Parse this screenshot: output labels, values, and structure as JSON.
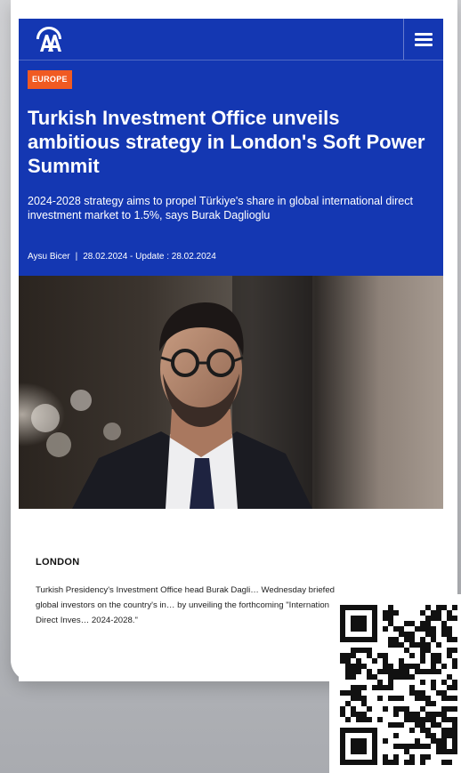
{
  "header": {
    "brand_logo": "AA",
    "menu_icon": "hamburger-menu-icon",
    "brand_color": "#1437b2",
    "category_color": "#f05a22"
  },
  "article": {
    "category": "EUROPE",
    "headline": "Turkish Investment Office unveils ambitious strategy in London's Soft Power Summit",
    "subheadline": "2024-2028 strategy aims to propel Türkiye's share in global international direct investment market to 1.5%, says Burak Daglioglu",
    "author": "Aysu Bicer",
    "byline_separator": "|",
    "dates": "28.02.2024 - Update : 28.02.2024",
    "dateline": "LONDON",
    "body": "Turkish Presidency's Investment Office head Burak Dagli… Wednesday briefed global investors on the country's in… by unveiling the forthcoming \"International Direct Inves… 2024-2028.\""
  },
  "overlay": {
    "qr_icon": "qr-code-icon"
  }
}
